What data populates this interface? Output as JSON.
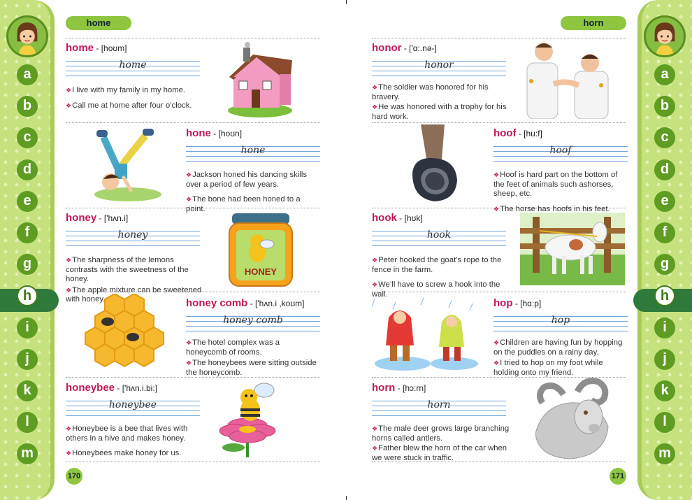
{
  "pages": {
    "left": {
      "guide_word": "home",
      "page_number": "170",
      "entries": [
        {
          "word": "home",
          "sep": " - ",
          "pron": "[hoʊm]",
          "cursive": "home",
          "ex": [
            "I live with my family in my home.",
            "Call me at home after four o’clock."
          ],
          "picture": "house-illustration"
        },
        {
          "word": "hone",
          "sep": " - ",
          "pron": "[hoʊn]",
          "cursive": "hone",
          "ex": [
            "Jackson honed his dancing skills over a period of few years.",
            "The bone had been honed to a point."
          ],
          "picture": "breakdancer-illustration"
        },
        {
          "word": "honey",
          "sep": " - ",
          "pron": "['hʌn.i]",
          "cursive": "honey",
          "ex": [
            "The sharpness of the lemons contrasts with the sweetness of the honey.",
            "The apple mixture can be sweetened with honey."
          ],
          "picture": "honey-jar-illustration",
          "jar_label": "HONEY"
        },
        {
          "word": "honey comb",
          "sep": " - ",
          "pron": "['hʌn.i ,koʊm]",
          "cursive": "honey comb",
          "ex": [
            "The hotel complex was a honeycomb of rooms.",
            "The honeybees were sitting outside the honeycomb."
          ],
          "picture": "honeycomb-illustration"
        },
        {
          "word": "honeybee",
          "sep": " - ",
          "pron": "['hʌn.i.bi:]",
          "cursive": "honeybee",
          "ex": [
            "Honeybee is a bee that lives with others in a hive and makes honey.",
            "Honeybees make honey for us."
          ],
          "picture": "bee-on-flower-illustration"
        }
      ]
    },
    "right": {
      "guide_word": "horn",
      "page_number": "171",
      "entries": [
        {
          "word": "honor",
          "sep": " - ",
          "pron": "['ɑ:.nə-]",
          "cursive": "honor",
          "ex": [
            "The soldier was honored for his bravery.",
            "He was honored with a trophy for his hard work."
          ],
          "picture": "handshake-illustration"
        },
        {
          "word": "hoof",
          "sep": " - ",
          "pron": "[hu:f]",
          "cursive": "hoof",
          "ex": [
            "Hoof is hard part on the bottom of the feet of animals such ashorses, sheep, etc.",
            "The horse has hoofs in his feet."
          ],
          "picture": "hoof-illustration"
        },
        {
          "word": "hook",
          "sep": " - ",
          "pron": "[hʊk]",
          "cursive": "hook",
          "ex": [
            "Peter hooked the goat’s rope to the fence in the farm.",
            "We’ll have to screw a hook into the wall."
          ],
          "picture": "goat-at-fence-illustration"
        },
        {
          "word": "hop",
          "sep": " - ",
          "pron": "[hɑ:p]",
          "cursive": "hop",
          "ex": [
            "Children are having fun by hopping on the puddles on a rainy day.",
            "I tried to hop on my foot while holding onto my friend."
          ],
          "picture": "children-hopping-illustration"
        },
        {
          "word": "horn",
          "sep": " - ",
          "pron": "[hɔ:rn]",
          "cursive": "horn",
          "ex": [
            "The male deer grows large branching horns called antlers.",
            "Father blew the horn of the car when we were stuck in traffic."
          ],
          "picture": "ram-illustration"
        }
      ]
    }
  },
  "alphabet": [
    "a",
    "b",
    "c",
    "d",
    "e",
    "f",
    "g",
    "h",
    "i",
    "j",
    "k",
    "l",
    "m"
  ],
  "active_letter": "h",
  "colors": {
    "strip": "#c6e27e",
    "letter": "#5e9c22",
    "headword": "#c2185b",
    "guide": "#8ec63f",
    "active": "#2f7a3a"
  }
}
